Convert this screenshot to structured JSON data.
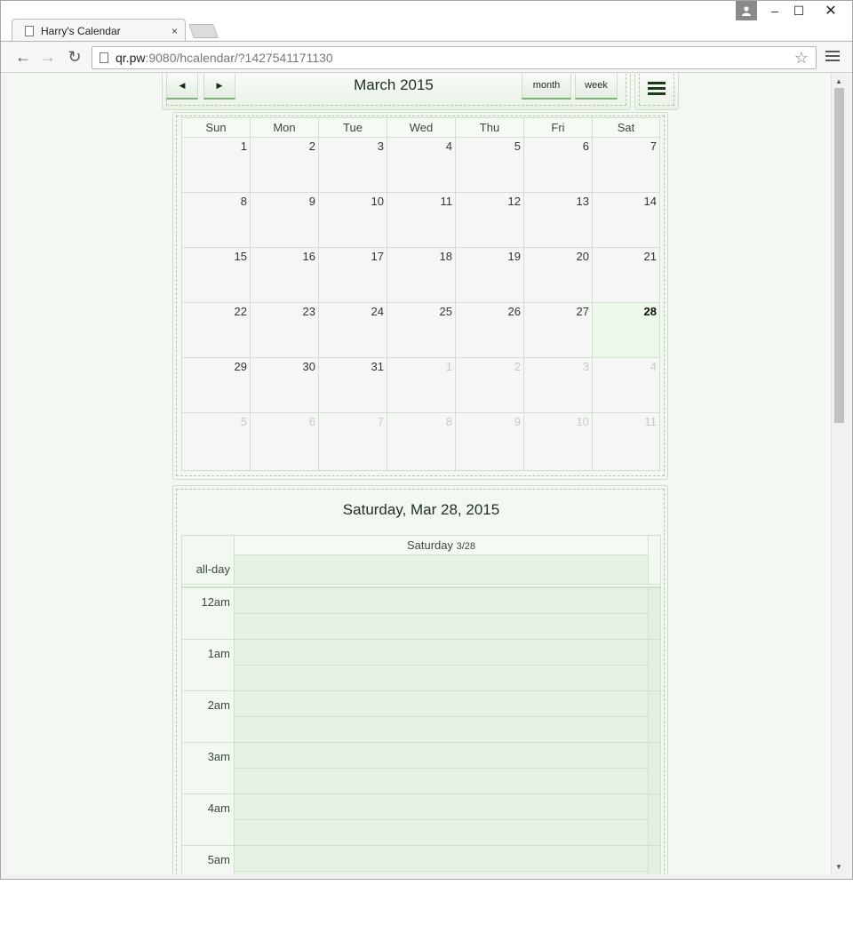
{
  "browser": {
    "tab_title": "Harry's Calendar",
    "tab_close": "×",
    "url_host": "qr.pw",
    "url_rest": ":9080/hcalendar/?1427541171130",
    "star": "☆",
    "controls": {
      "minimize": "–",
      "maximize": "☐",
      "close": "✕"
    }
  },
  "calendar": {
    "header_title": "March 2015",
    "prev_glyph": "◀",
    "next_glyph": "▶",
    "month_label": "month",
    "week_label": "week",
    "weekdays": [
      "Sun",
      "Mon",
      "Tue",
      "Wed",
      "Thu",
      "Fri",
      "Sat"
    ],
    "weeks": [
      [
        "1",
        "2",
        "3",
        "4",
        "5",
        "6",
        "7"
      ],
      [
        "8",
        "9",
        "10",
        "11",
        "12",
        "13",
        "14"
      ],
      [
        "15",
        "16",
        "17",
        "18",
        "19",
        "20",
        "21"
      ],
      [
        "22",
        "23",
        "24",
        "25",
        "26",
        "27",
        "28"
      ],
      [
        "29",
        "30",
        "31",
        "1",
        "2",
        "3",
        "4"
      ],
      [
        "5",
        "6",
        "7",
        "8",
        "9",
        "10",
        "11"
      ]
    ]
  },
  "day_view": {
    "title": "Saturday, Mar 28, 2015",
    "column_head": "Saturday",
    "column_date": "3/28",
    "all_day_label": "all-day",
    "hours": [
      "12am",
      "1am",
      "2am",
      "3am",
      "4am",
      "5am"
    ]
  },
  "colors": {
    "accent_green": "#7fae7a",
    "page_bg": "#f4f8f3",
    "slot_bg": "#e6f2e4"
  }
}
